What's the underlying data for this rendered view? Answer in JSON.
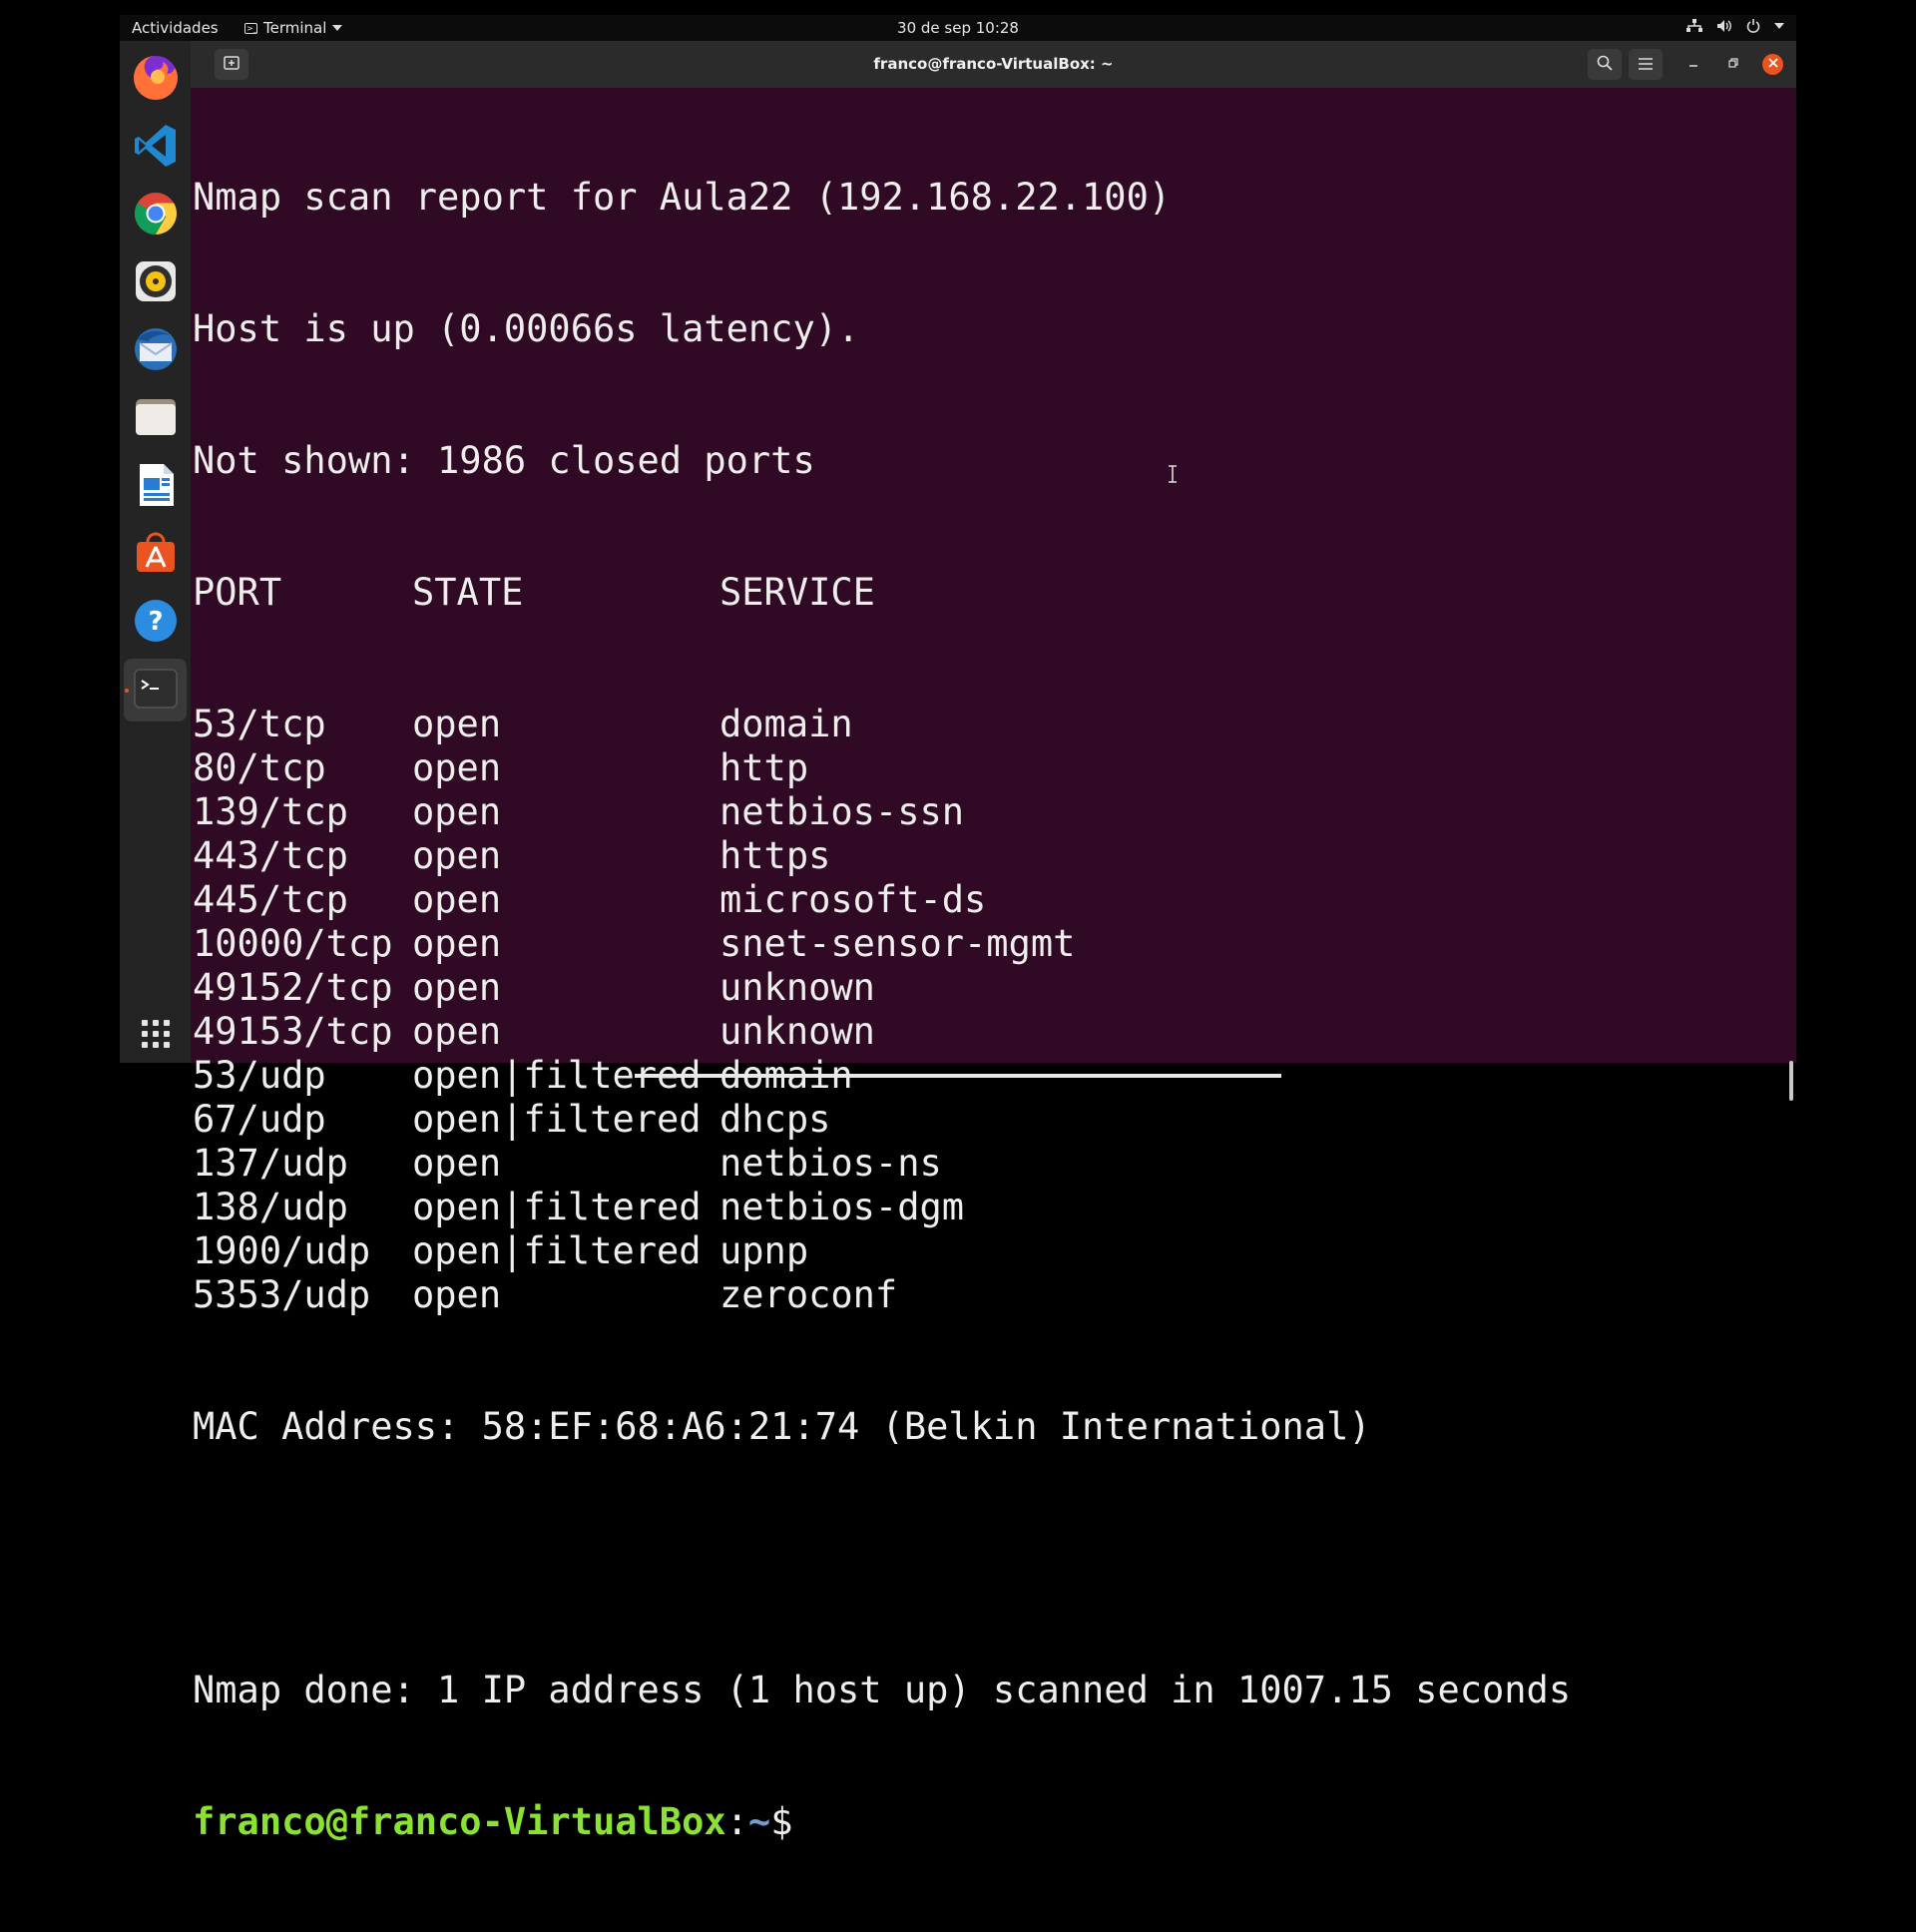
{
  "topbar": {
    "activities": "Actividades",
    "app_menu_label": "Terminal",
    "clock": "30 de sep  10:28",
    "tray_icons": [
      "network-icon",
      "volume-icon",
      "power-icon",
      "chevron-down-icon"
    ]
  },
  "dock": {
    "items": [
      {
        "name": "Firefox",
        "icon": "firefox-icon",
        "color": "#ff7139"
      },
      {
        "name": "Visual Studio Code",
        "icon": "vscode-icon",
        "color": "#1f8ad2"
      },
      {
        "name": "Google Chrome",
        "icon": "chrome-icon",
        "color": "#4285f4"
      },
      {
        "name": "Rhythmbox",
        "icon": "rhythmbox-icon",
        "color": "#f5c211"
      },
      {
        "name": "Thunderbird",
        "icon": "thunderbird-icon",
        "color": "#2a6fb8"
      },
      {
        "name": "Files",
        "icon": "files-icon",
        "color": "#e0d9cf"
      },
      {
        "name": "LibreOffice Writer",
        "icon": "writer-icon",
        "color": "#2a7cd0"
      },
      {
        "name": "Ubuntu Software",
        "icon": "software-icon",
        "color": "#e95420"
      },
      {
        "name": "Help",
        "icon": "help-icon",
        "color": "#2c8de0"
      },
      {
        "name": "Terminal",
        "icon": "terminal-icon",
        "color": "#333333"
      }
    ],
    "show_apps_icon": "grid-icon"
  },
  "window": {
    "title": "franco@franco-VirtualBox: ~"
  },
  "terminal": {
    "header_lines": [
      "Nmap scan report for Aula22 (192.168.22.100)",
      "Host is up (0.00066s latency).",
      "Not shown: 1986 closed ports"
    ],
    "columns": [
      "PORT",
      "STATE",
      "SERVICE"
    ],
    "rows": [
      [
        "53/tcp",
        "open",
        "domain"
      ],
      [
        "80/tcp",
        "open",
        "http"
      ],
      [
        "139/tcp",
        "open",
        "netbios-ssn"
      ],
      [
        "443/tcp",
        "open",
        "https"
      ],
      [
        "445/tcp",
        "open",
        "microsoft-ds"
      ],
      [
        "10000/tcp",
        "open",
        "snet-sensor-mgmt"
      ],
      [
        "49152/tcp",
        "open",
        "unknown"
      ],
      [
        "49153/tcp",
        "open",
        "unknown"
      ],
      [
        "53/udp",
        "open|filtered",
        "domain"
      ],
      [
        "67/udp",
        "open|filtered",
        "dhcps"
      ],
      [
        "137/udp",
        "open",
        "netbios-ns"
      ],
      [
        "138/udp",
        "open|filtered",
        "netbios-dgm"
      ],
      [
        "1900/udp",
        "open|filtered",
        "upnp"
      ],
      [
        "5353/udp",
        "open",
        "zeroconf"
      ]
    ],
    "mac_line": "MAC Address: 58:EF:68:A6:21:74 (Belkin International)",
    "blank_line": "",
    "done_line": "Nmap done: 1 IP address (1 host up) scanned in 1007.15 seconds",
    "prompt_user": "franco@franco-VirtualBox",
    "prompt_sep": ":",
    "prompt_path": "~",
    "prompt_symbol": "$"
  },
  "colors": {
    "terminal_bg": "#300a24",
    "prompt_user": "#8ae234",
    "prompt_path": "#729fcf",
    "accent": "#e95420"
  }
}
